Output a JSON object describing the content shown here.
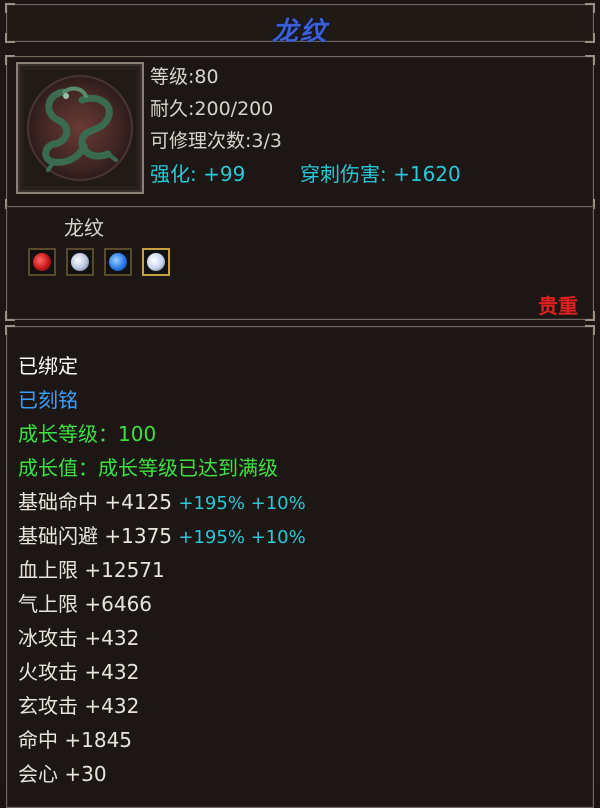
{
  "title": "龙纹",
  "item_icon": "dragon-emblem-icon",
  "header": {
    "level": "等级:80",
    "durability": "耐久:200/200",
    "repairs": "可修理次数:3/3",
    "enhance": "强化: +99",
    "pierce": "穿刺伤害: +1620"
  },
  "gem_section": {
    "name": "龙纹",
    "gems": [
      {
        "icon": "red-gem-icon",
        "color": "#c81818"
      },
      {
        "icon": "white-gem-icon",
        "color": "#d8e0f0"
      },
      {
        "icon": "blue-gem-icon",
        "color": "#2a7ae8"
      },
      {
        "icon": "white-gem-icon",
        "color": "#e0e8f8"
      }
    ],
    "rarity": "贵重"
  },
  "status": {
    "bound": "已绑定",
    "engraved": "已刻铭",
    "growth_level": "成长等级：100",
    "growth_value": "成长值：成长等级已达到满级"
  },
  "attributes": [
    {
      "label": "基础命中 +4125",
      "extra": "+195% +10%"
    },
    {
      "label": "基础闪避 +1375",
      "extra": "+195% +10%"
    },
    {
      "label": "血上限 +12571",
      "extra": ""
    },
    {
      "label": "气上限 +6466",
      "extra": ""
    },
    {
      "label": "冰攻击 +432",
      "extra": ""
    },
    {
      "label": "火攻击 +432",
      "extra": ""
    },
    {
      "label": "玄攻击 +432",
      "extra": ""
    },
    {
      "label": "命中 +1845",
      "extra": ""
    },
    {
      "label": "会心 +30",
      "extra": ""
    }
  ],
  "colors": {
    "title": "#3a5fd6",
    "cyan": "#29c8d8",
    "green": "#3ee040",
    "blue": "#3aa0ff",
    "rarity": "#e02020"
  }
}
